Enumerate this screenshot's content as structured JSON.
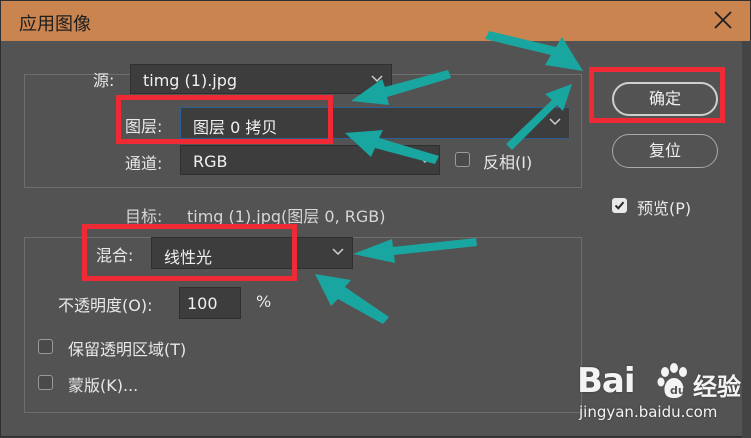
{
  "dialog": {
    "title": "应用图像",
    "accent_color": "#c9844f",
    "close_icon": "close-icon"
  },
  "source": {
    "label": "源:",
    "file": "timg (1).jpg",
    "layer_label": "图层:",
    "layer_value": "图层 0 拷贝",
    "channel_label": "通道:",
    "channel_value": "RGB",
    "invert_label": "反相(I)",
    "invert_checked": false
  },
  "target": {
    "label": "目标:",
    "value": "timg (1).jpg(图层 0, RGB)"
  },
  "blending": {
    "label": "混合:",
    "value": "线性光",
    "opacity_label": "不透明度(O):",
    "opacity_value": "100",
    "opacity_unit": "%",
    "preserve_transparency_label": "保留透明区域(T)",
    "preserve_transparency_checked": false,
    "mask_label": "蒙版(K)...",
    "mask_checked": false
  },
  "buttons": {
    "ok": "确定",
    "reset": "复位"
  },
  "preview": {
    "label": "预览(P)",
    "checked": true
  },
  "annotation_colors": {
    "highlight_box": "#ee2b35",
    "arrow": "#1aa6a0"
  },
  "watermark": {
    "logo": "Bai",
    "logo_suffix": "经验",
    "url": "jingyan.baidu.com"
  }
}
